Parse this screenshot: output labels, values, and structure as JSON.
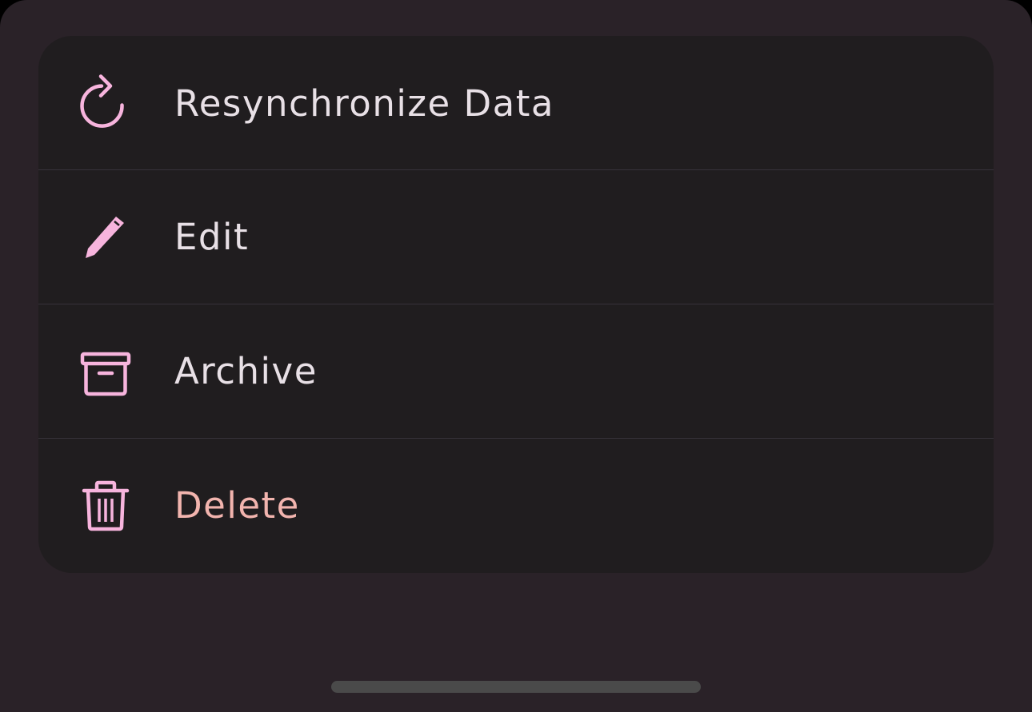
{
  "theme": {
    "sheet_background": "#2a2228",
    "card_background": "#201d1f",
    "icon_color": "#f7b4dd",
    "text_color": "#e8e0e6",
    "danger_text_color": "#f2b4ae",
    "divider_color": "#37323a",
    "home_indicator_color": "#4a4a4a"
  },
  "menu": {
    "items": [
      {
        "icon": "refresh-icon",
        "label": "Resynchronize Data"
      },
      {
        "icon": "pencil-icon",
        "label": "Edit"
      },
      {
        "icon": "archive-box-icon",
        "label": "Archive"
      },
      {
        "icon": "trash-icon",
        "label": "Delete",
        "destructive": true
      }
    ]
  }
}
